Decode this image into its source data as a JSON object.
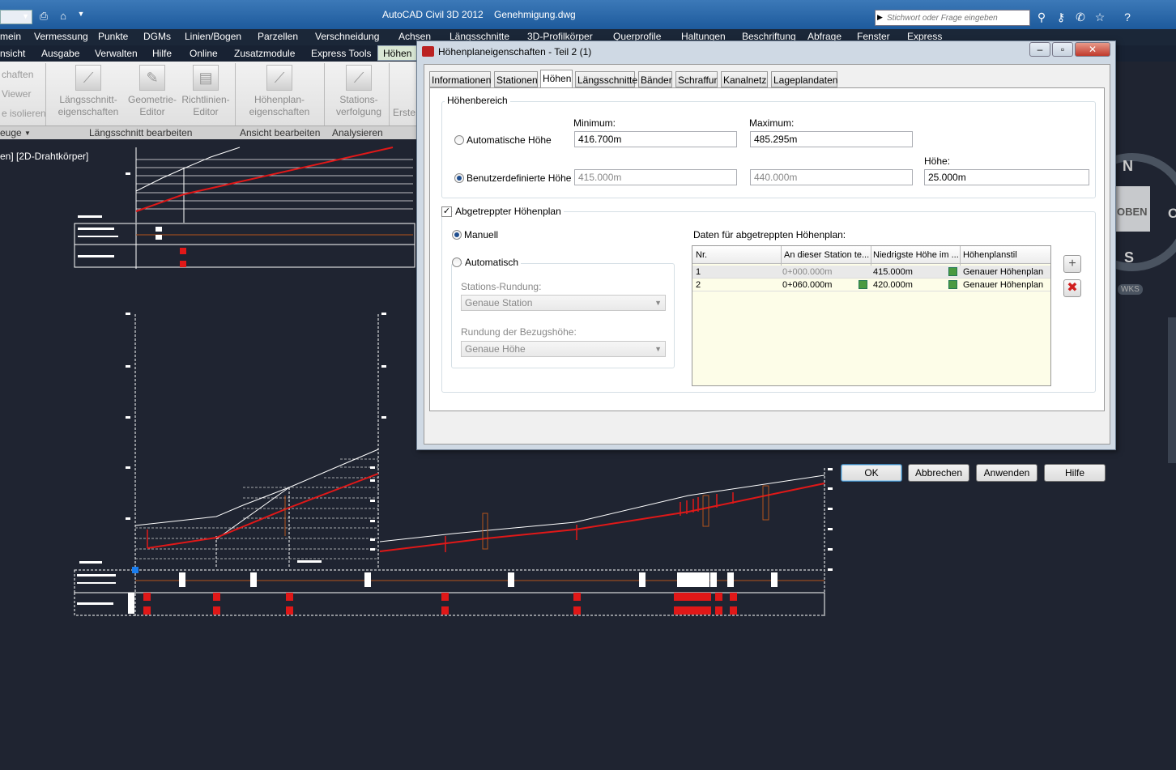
{
  "titlebar": {
    "app_name": "AutoCAD Civil 3D 2012",
    "file_name": "Genehmigung.dwg",
    "search_placeholder": "Stichwort oder Frage eingeben"
  },
  "menu": [
    "mein",
    "Vermessung",
    "Punkte",
    "DGMs",
    "Linien/Bogen",
    "Parzellen",
    "Verschneidung",
    "Achsen",
    "Längsschnitte",
    "3D-Profilkörper",
    "Querprofile",
    "Haltungen",
    "Beschriftung",
    "Abfrage",
    "Fenster",
    "Express"
  ],
  "ribbon_tabs": [
    "nsicht",
    "Ausgabe",
    "Verwalten",
    "Hilfe",
    "Online",
    "Zusatzmodule",
    "Express Tools",
    "Höhen"
  ],
  "ribbon": {
    "left_items": [
      "chaften",
      "Viewer",
      "e isolieren",
      "euge"
    ],
    "buttons": [
      {
        "l1": "Längsschnitt-",
        "l2": "eigenschaften"
      },
      {
        "l1": "Geometrie-",
        "l2": "Editor"
      },
      {
        "l1": "Richtlinien-",
        "l2": "Editor"
      },
      {
        "l1": "Höhenplan-",
        "l2": "eigenschaften"
      },
      {
        "l1": "Stations-",
        "l2": "verfolgung"
      },
      {
        "l1": "Erste",
        "l2": ""
      }
    ],
    "panels": [
      "Längsschnitt bearbeiten",
      "Ansicht bearbeiten",
      "Analysieren"
    ]
  },
  "viewport_label": "en] [2D-Drahtkörper]",
  "viewcube": {
    "n": "N",
    "s": "S",
    "top": "OBEN",
    "o": "O",
    "wcs": "WKS"
  },
  "dialog": {
    "title": "Höhenplaneigenschaften - Teil 2 (1)",
    "tabs": [
      "Informationen",
      "Stationen",
      "Höhen",
      "Längsschnitte",
      "Bänder",
      "Schraffur",
      "Kanalnetz",
      "Lageplandaten"
    ],
    "active_tab": "Höhen",
    "height_range": {
      "group_title": "Höhenbereich",
      "min_label": "Minimum:",
      "max_label": "Maximum:",
      "height_label": "Höhe:",
      "auto_label": "Automatische Höhe",
      "user_label": "Benutzerdefinierte Höhe",
      "auto_min": "416.700m",
      "auto_max": "485.295m",
      "user_min": "415.000m",
      "user_max": "440.000m",
      "user_height": "25.000m",
      "selected": "user"
    },
    "staggered": {
      "checkbox_label": "Abgetreppter Höhenplan",
      "checked": true,
      "manual_label": "Manuell",
      "auto_label": "Automatisch",
      "station_rounding_label": "Stations-Rundung:",
      "station_rounding_value": "Genaue Station",
      "ref_rounding_label": "Rundung der Bezugshöhe:",
      "ref_rounding_value": "Genaue Höhe",
      "table_title": "Daten für abgetreppten Höhenplan:",
      "columns": [
        "Nr.",
        "An dieser Station te...",
        "Niedrigste Höhe im ...",
        "Höhenplanstil"
      ],
      "rows": [
        {
          "nr": "1",
          "station": "0+000.000m",
          "elev": "415.000m",
          "style": "Genauer Höhenplan"
        },
        {
          "nr": "2",
          "station": "0+060.000m",
          "elev": "420.000m",
          "style": "Genauer Höhenplan"
        }
      ]
    },
    "buttons": {
      "ok": "OK",
      "cancel": "Abbrechen",
      "apply": "Anwenden",
      "help": "Hilfe"
    }
  }
}
